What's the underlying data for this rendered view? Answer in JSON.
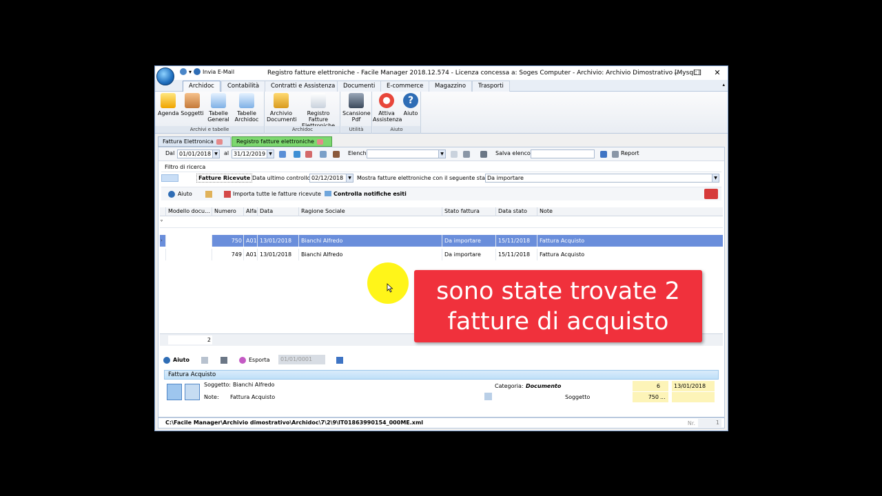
{
  "window": {
    "title": "Registro fatture elettroniche - Facile Manager 2018.12.574 - Licenza concessa a: Soges Computer - Archivio: Archivio Dimostrativo  [Mysql: ]",
    "qat_label": "Invia E-Mail",
    "controls": {
      "minimize": "–",
      "maximize": "☐",
      "close": "✕"
    }
  },
  "ribbon": {
    "tabs": [
      "Archidoc",
      "Contabilità",
      "Contratti e Assistenza",
      "Documenti",
      "E-commerce",
      "Magazzino",
      "Trasporti"
    ],
    "groups": [
      {
        "label": "Archivi e tabelle",
        "buttons": [
          "Agenda",
          "Soggetti",
          "Tabelle General",
          "Tabelle Archidoc"
        ]
      },
      {
        "label": "Archidoc",
        "buttons": [
          "Archivio Documenti",
          "Registro Fatture Elettroniche"
        ]
      },
      {
        "label": "Utilità",
        "buttons": [
          "Scansione Pdf"
        ]
      },
      {
        "label": "Aiuto",
        "buttons": [
          "Attiva Assistenza",
          "Aiuto"
        ]
      }
    ]
  },
  "doc_tabs": [
    "Fattura Elettronica",
    "Registro fatture elettroniche"
  ],
  "toolbar": {
    "dal_label": "Dal",
    "dal_value": "01/01/2018",
    "al_label": "al",
    "al_value": "31/12/2019",
    "elenchi_label": "Elenchi",
    "elenchi_value": "",
    "salva_label": "Salva elenco",
    "salva_value": "",
    "report_label": "Report"
  },
  "filter": {
    "title": "Filtro di ricerca",
    "fatture_ricevute": "Fatture Ricevute",
    "data_controllo_label": "Data ultimo controllo",
    "data_controllo_value": "02/12/2018",
    "stato_label": "Mostra fatture elettroniche con il seguente stato",
    "stato_value": "Da importare",
    "aiuto": "Aiuto",
    "importa": "Importa tutte le fatture ricevute",
    "controlla": "Controlla notifiche esiti"
  },
  "grid": {
    "columns": [
      "Modello docu...",
      "Numero",
      "Alfa",
      "Data",
      "Ragione Sociale",
      "Stato fattura",
      "Data stato",
      "Note"
    ],
    "rows": [
      {
        "numero": "750",
        "alfa": "A01",
        "data": "13/01/2018",
        "ragione": "Bianchi Alfredo",
        "stato": "Da importare",
        "data_stato": "15/11/2018",
        "note": "Fattura Acquisto"
      },
      {
        "numero": "749",
        "alfa": "A01",
        "data": "13/01/2018",
        "ragione": "Bianchi Alfredo",
        "stato": "Da importare",
        "data_stato": "15/11/2018",
        "note": "Fattura Acquisto"
      }
    ],
    "count": "2"
  },
  "bottom_toolbar": {
    "aiuto": "Aiuto",
    "esporta": "Esporta",
    "date_value": "01/01/0001"
  },
  "detail": {
    "header": "Fattura Acquisto",
    "soggetto_label": "Soggetto:",
    "soggetto_value": "Bianchi Alfredo",
    "note_label": "Note:",
    "note_value": "Fattura Acquisto",
    "categoria_label": "Categoria:",
    "categoria_value": "Documento",
    "num1": "6",
    "date1": "13/01/2018",
    "soggetto2_label": "Soggetto",
    "num2": "750",
    "dots": "..."
  },
  "status": {
    "path": "C:\\Facile Manager\\Archivio dimostrativo\\Archidoc\\7\\2\\9\\IT01863990154_000ME.xml",
    "nr_label": "Nr.",
    "nr_value": "1"
  },
  "callout": {
    "line1": "sono state trovate 2",
    "line2": "fatture di acquisto"
  }
}
